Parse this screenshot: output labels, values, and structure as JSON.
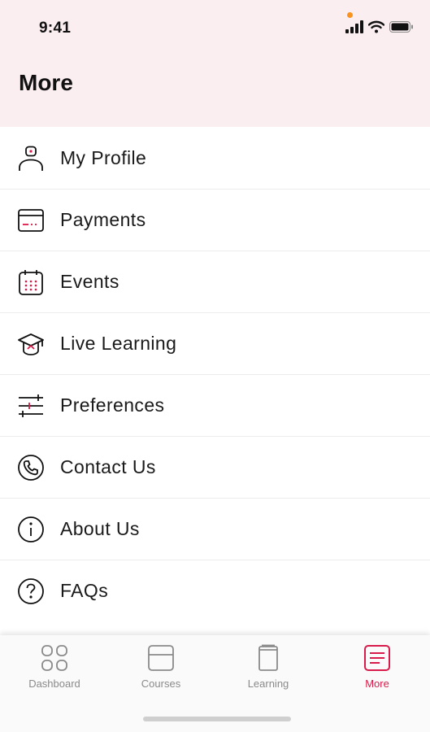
{
  "status_bar": {
    "time": "9:41",
    "icons": [
      "signal-icon",
      "wifi-icon",
      "battery-icon"
    ],
    "indicator_color": "#f7931e"
  },
  "header": {
    "title": "More",
    "background": "#fbeef1"
  },
  "menu": {
    "items": [
      {
        "label": "My Profile",
        "icon": "profile-icon"
      },
      {
        "label": "Payments",
        "icon": "payments-icon"
      },
      {
        "label": "Events",
        "icon": "calendar-icon"
      },
      {
        "label": "Live Learning",
        "icon": "graduation-cap-icon"
      },
      {
        "label": "Preferences",
        "icon": "sliders-icon"
      },
      {
        "label": "Contact Us",
        "icon": "phone-icon"
      },
      {
        "label": "About Us",
        "icon": "info-icon"
      },
      {
        "label": "FAQs",
        "icon": "question-icon"
      }
    ]
  },
  "tabbar": {
    "active_tab": "More",
    "accent_color": "#d81b4a",
    "tabs": [
      {
        "label": "Dashboard",
        "icon": "dashboard-icon"
      },
      {
        "label": "Courses",
        "icon": "courses-icon"
      },
      {
        "label": "Learning",
        "icon": "book-icon"
      },
      {
        "label": "More",
        "icon": "more-icon"
      }
    ]
  }
}
